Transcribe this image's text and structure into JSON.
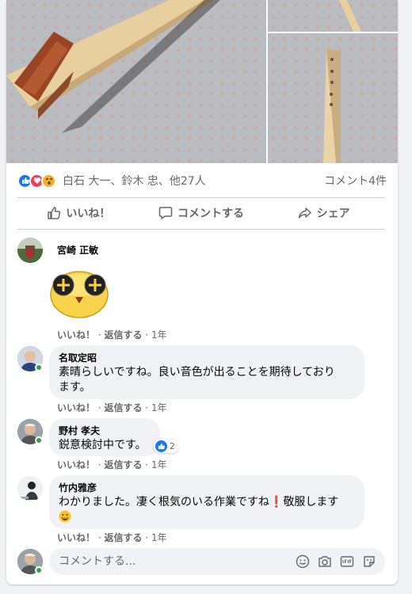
{
  "post": {
    "reactions": {
      "names": "白石 大一、鈴木 忠、他27人",
      "comment_count": "コメント4件",
      "types": [
        "like-icon",
        "love-icon",
        "wow-icon"
      ]
    },
    "actions": {
      "like": "いいね！",
      "comment": "コメントする",
      "share": "シェア"
    }
  },
  "comments": [
    {
      "author": "宮崎 正敏",
      "text": "",
      "sticker": "sunglasses-sticker",
      "like": "いいね！",
      "reply": "返信する",
      "time": "1年"
    },
    {
      "author": "名取定昭",
      "text": "素晴らしいですね。良い音色が出ることを期待しております。",
      "line1": "素晴らしいですね。良い音色が出ることを期待しており",
      "line2": "ます。",
      "like": "いいね！",
      "reply": "返信する",
      "time": "1年"
    },
    {
      "author": "野村 孝夫",
      "text": "鋭意検討中です。",
      "reaction_count": "2",
      "like": "いいね！",
      "reply": "返信する",
      "time": "1年"
    },
    {
      "author": "竹内雅彦",
      "text": "わかりました。凄く根気のいる作業ですね❗敬服します😀",
      "line1": "わかりました。凄く根気のいる作業ですね",
      "line1b": "敬服します",
      "like": "いいね！",
      "reply": "返信する",
      "time": "1年"
    }
  ],
  "composer": {
    "placeholder": "コメントする...",
    "icons": [
      "emoji-icon",
      "camera-icon",
      "gif-icon",
      "sticker-icon"
    ]
  },
  "colors": {
    "accent": "#1877f2",
    "muted": "#65676b",
    "bubble": "#f0f2f5",
    "online": "#31a24c"
  }
}
